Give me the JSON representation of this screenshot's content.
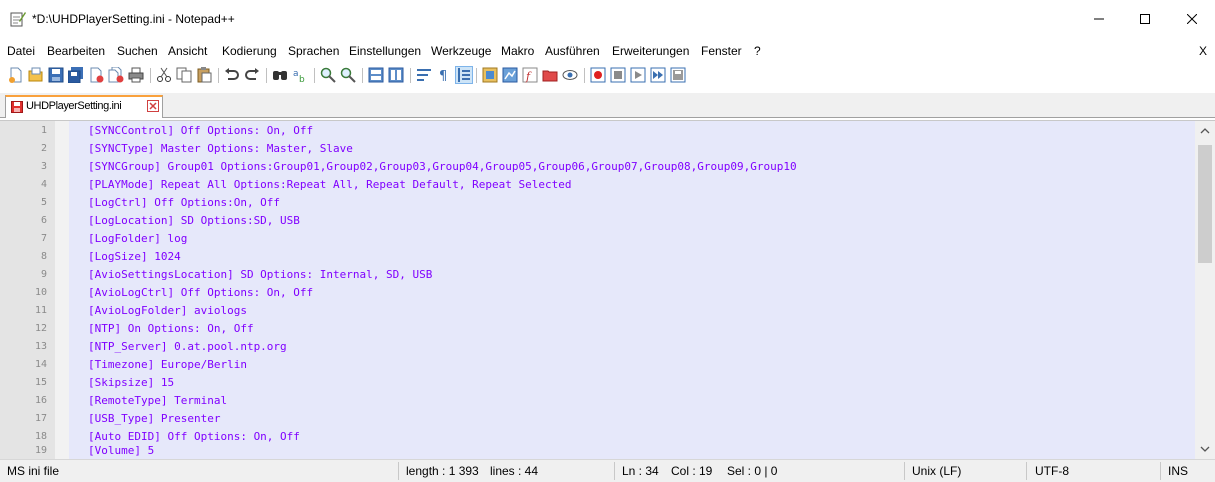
{
  "window": {
    "title": "*D:\\UHDPlayerSetting.ini - Notepad++",
    "controls": [
      "minimize-icon",
      "maximize-icon",
      "close-icon"
    ]
  },
  "menu": {
    "items": [
      "Datei",
      "Bearbeiten",
      "Suchen",
      "Ansicht",
      "Kodierung",
      "Sprachen",
      "Einstellungen",
      "Werkzeuge",
      "Makro",
      "Ausführen",
      "Erweiterungen",
      "Fenster",
      "?"
    ],
    "close_doc": "X"
  },
  "toolbar": {
    "icons": [
      "new-file-icon",
      "open-file-icon",
      "save-icon",
      "save-all-icon",
      "close-icon",
      "close-all-icon",
      "print-icon",
      "cut-icon",
      "copy-icon",
      "paste-icon",
      "undo-icon",
      "redo-icon",
      "find-icon",
      "replace-icon",
      "zoom-in-icon",
      "zoom-out-icon",
      "sync-vertical-icon",
      "sync-horizontal-icon",
      "word-wrap-icon",
      "show-all-characters-icon",
      "indent-guide-icon",
      "user-language-icon",
      "document-map-icon",
      "function-list-icon",
      "folder-workspace-icon",
      "monitoring-icon",
      "record-macro-icon",
      "stop-macro-icon",
      "play-macro-icon",
      "run-macro-multiple-icon",
      "save-macro-icon"
    ]
  },
  "tab": {
    "label": "UHDPlayerSetting.ini",
    "unsaved_color": "#e0312f",
    "active_accent": "#f9a13c"
  },
  "editor": {
    "text_color": "#8000ff",
    "background": "#e6e8fa",
    "lines": [
      {
        "number": "1",
        "text": "[SYNCControl] Off Options: On, Off"
      },
      {
        "number": "2",
        "text": "[SYNCType] Master Options: Master, Slave"
      },
      {
        "number": "3",
        "text": "[SYNCGroup] Group01 Options:Group01,Group02,Group03,Group04,Group05,Group06,Group07,Group08,Group09,Group10"
      },
      {
        "number": "4",
        "text": "[PLAYMode] Repeat All Options:Repeat All, Repeat Default, Repeat Selected"
      },
      {
        "number": "5",
        "text": "[LogCtrl] Off Options:On, Off"
      },
      {
        "number": "6",
        "text": "[LogLocation] SD Options:SD, USB"
      },
      {
        "number": "7",
        "text": "[LogFolder] log"
      },
      {
        "number": "8",
        "text": "[LogSize] 1024"
      },
      {
        "number": "9",
        "text": "[AvioSettingsLocation] SD Options: Internal, SD, USB"
      },
      {
        "number": "10",
        "text": "[AvioLogCtrl] Off Options: On, Off"
      },
      {
        "number": "11",
        "text": "[AvioLogFolder] aviologs"
      },
      {
        "number": "12",
        "text": "[NTP] On Options: On, Off"
      },
      {
        "number": "13",
        "text": "[NTP_Server] 0.at.pool.ntp.org"
      },
      {
        "number": "14",
        "text": "[Timezone] Europe/Berlin"
      },
      {
        "number": "15",
        "text": "[Skipsize] 15"
      },
      {
        "number": "16",
        "text": "[RemoteType] Terminal"
      },
      {
        "number": "17",
        "text": "[USB_Type] Presenter"
      },
      {
        "number": "18",
        "text": "[Auto EDID] Off Options: On, Off"
      },
      {
        "number": "19",
        "text": "[Volume] 5"
      }
    ]
  },
  "status": {
    "file_type": "MS ini file",
    "length": "length : 1 393",
    "lines": "lines : 44",
    "ln": "Ln : 34",
    "col": "Col : 19",
    "sel": "Sel : 0 | 0",
    "eol": "Unix (LF)",
    "encoding": "UTF-8",
    "mode": "INS"
  }
}
